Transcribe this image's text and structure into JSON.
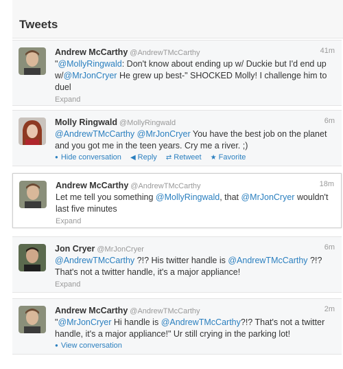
{
  "header": {
    "title": "Tweets"
  },
  "tweets": [
    {
      "name": "Andrew McCarthy",
      "handle": "@AndrewTMcCarthy",
      "time": "41m",
      "text_parts": [
        {
          "t": "\"",
          "m": false
        },
        {
          "t": "@MollyRingwald",
          "m": true
        },
        {
          "t": ": Don't know about ending up w/ Duckie but I'd end up w/",
          "m": false
        },
        {
          "t": "@MrJonCryer",
          "m": true
        },
        {
          "t": " He grew up best-\" SHOCKED Molly! I challenge him to duel",
          "m": false
        }
      ],
      "expand": "Expand"
    },
    {
      "name": "Molly Ringwald",
      "handle": "@MollyRingwald",
      "time": "6m",
      "text_parts": [
        {
          "t": "@AndrewTMcCarthy",
          "m": true
        },
        {
          "t": " ",
          "m": false
        },
        {
          "t": "@MrJonCryer",
          "m": true
        },
        {
          "t": " You have the best job on the planet and you got me in the teen years. Cry me a river. ;)",
          "m": false
        }
      ],
      "actions": {
        "hide": "Hide conversation",
        "reply": "Reply",
        "retweet": "Retweet",
        "favorite": "Favorite"
      }
    },
    {
      "name": "Andrew McCarthy",
      "handle": "@AndrewTMcCarthy",
      "time": "18m",
      "text_parts": [
        {
          "t": "Let me tell you something ",
          "m": false
        },
        {
          "t": "@MollyRingwald",
          "m": true
        },
        {
          "t": ", that ",
          "m": false
        },
        {
          "t": "@MrJonCryer",
          "m": true
        },
        {
          "t": " wouldn't last five minutes",
          "m": false
        }
      ],
      "expand": "Expand"
    },
    {
      "name": "Jon Cryer",
      "handle": "@MrJonCryer",
      "time": "6m",
      "text_parts": [
        {
          "t": "@AndrewTMcCarthy",
          "m": true
        },
        {
          "t": " ?!? His twitter handle is ",
          "m": false
        },
        {
          "t": "@AndrewTMcCarthy",
          "m": true
        },
        {
          "t": " ?!? That's not a twitter handle, it's a major appliance!",
          "m": false
        }
      ],
      "expand": "Expand"
    },
    {
      "name": "Andrew McCarthy",
      "handle": "@AndrewTMcCarthy",
      "time": "2m",
      "text_parts": [
        {
          "t": "\"",
          "m": false
        },
        {
          "t": "@MrJonCryer",
          "m": true
        },
        {
          "t": " Hi handle is ",
          "m": false
        },
        {
          "t": "@AndrewTMcCarthy",
          "m": true
        },
        {
          "t": "?!? That's not a twitter handle, it's a major appliance!\" Ur still crying in the parking lot!",
          "m": false
        }
      ],
      "view": "View conversation"
    }
  ],
  "colors": {
    "link": "#2a7fbf",
    "muted": "#999999",
    "text": "#333333"
  },
  "icons": {
    "reply": "reply-arrow-icon",
    "retweet": "retweet-icon",
    "favorite": "star-icon",
    "conversation": "bullet-dot-icon"
  }
}
